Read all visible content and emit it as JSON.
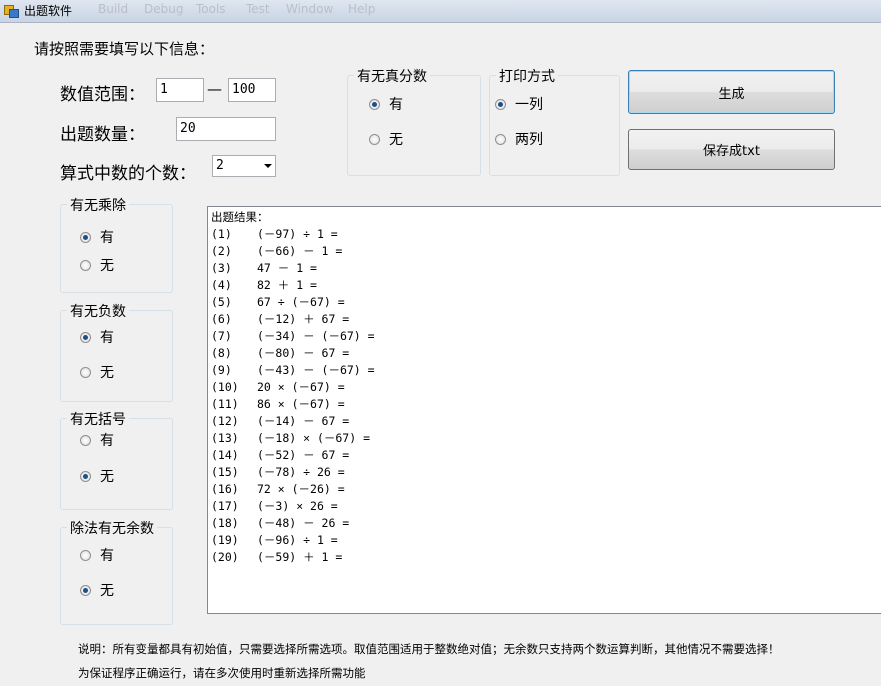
{
  "window": {
    "title": "出题软件",
    "menu": [
      "Build",
      "Debug",
      "Tools",
      "Test",
      "Window",
      "Help"
    ]
  },
  "header": {
    "instruction": "请按照需要填写以下信息："
  },
  "fields": {
    "range_label": "数值范围：",
    "range_min": "1",
    "range_sep": "—",
    "range_max": "100",
    "count_label": "出题数量：",
    "count_value": "20",
    "operand_label": "算式中数的个数：",
    "operand_value": "2"
  },
  "groups": {
    "proper_fraction": {
      "title": "有无真分数",
      "options": [
        "有",
        "无"
      ],
      "selected": "有"
    },
    "print_mode": {
      "title": "打印方式",
      "options": [
        "一列",
        "两列"
      ],
      "selected": "一列"
    },
    "muldiv": {
      "title": "有无乘除",
      "options": [
        "有",
        "无"
      ],
      "selected": "有"
    },
    "negative": {
      "title": "有无负数",
      "options": [
        "有",
        "无"
      ],
      "selected": "有"
    },
    "brackets": {
      "title": "有无括号",
      "options": [
        "有",
        "无"
      ],
      "selected": "无"
    },
    "remainder": {
      "title": "除法有无余数",
      "options": [
        "有",
        "无"
      ],
      "selected": "无"
    }
  },
  "buttons": {
    "generate": "生成",
    "save": "保存成txt"
  },
  "output": {
    "header": "出题结果：",
    "lines": [
      {
        "num": "(1)",
        "expr": "(－97) ÷ 1 ="
      },
      {
        "num": "(2)",
        "expr": "(－66) － 1 ="
      },
      {
        "num": "(3)",
        "expr": "47 － 1 ="
      },
      {
        "num": "(4)",
        "expr": "82 ＋ 1 ="
      },
      {
        "num": "(5)",
        "expr": "67 ÷ (－67) ="
      },
      {
        "num": "(6)",
        "expr": "(－12) ＋ 67 ="
      },
      {
        "num": "(7)",
        "expr": "(－34) － (－67) ="
      },
      {
        "num": "(8)",
        "expr": "(－80) － 67 ="
      },
      {
        "num": "(9)",
        "expr": "(－43) － (－67) ="
      },
      {
        "num": "(10)",
        "expr": "20 × (－67) ="
      },
      {
        "num": "(11)",
        "expr": "86 × (－67) ="
      },
      {
        "num": "(12)",
        "expr": "(－14) － 67 ="
      },
      {
        "num": "(13)",
        "expr": "(－18) × (－67) ="
      },
      {
        "num": "(14)",
        "expr": "(－52) － 67 ="
      },
      {
        "num": "(15)",
        "expr": "(－78) ÷ 26 ="
      },
      {
        "num": "(16)",
        "expr": "72 × (－26) ="
      },
      {
        "num": "(17)",
        "expr": "(－3) × 26 ="
      },
      {
        "num": "(18)",
        "expr": "(－48) － 26 ="
      },
      {
        "num": "(19)",
        "expr": "(－96) ÷ 1 ="
      },
      {
        "num": "(20)",
        "expr": "(－59) ＋ 1 ="
      }
    ]
  },
  "notes": {
    "line1": "说明：所有变量都具有初始值，只需要选择所需选项。取值范围适用于整数绝对值；无余数只支持两个数运算判断，其他情况不需要选择！",
    "line2": "为保证程序正确运行，请在多次使用时重新选择所需功能"
  }
}
